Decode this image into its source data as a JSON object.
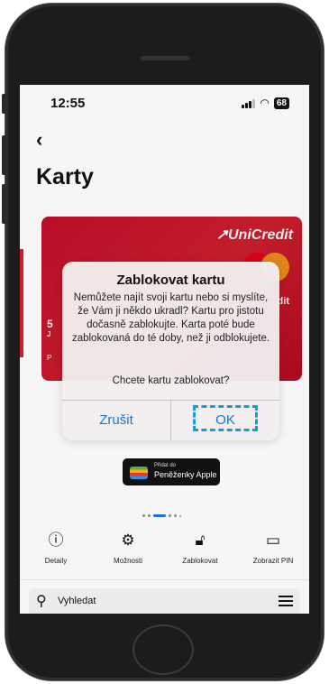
{
  "status_bar": {
    "time": "12:55",
    "battery": "68"
  },
  "nav": {
    "back_icon": "chevron-left-icon",
    "title": "Karty"
  },
  "card": {
    "brand": "UniCredit",
    "fragment_right": "dit",
    "fragment_5": "5",
    "fragment_j": "J",
    "fragment_p": "P"
  },
  "dialog": {
    "title": "Zablokovat kartu",
    "message": "Nemůžete najít svoji kartu nebo si myslíte, že Vám ji někdo ukradl? Kartu pro jistotu dočasně zablokujte. Karta poté bude zablokovaná do té doby, než ji odblokujete.",
    "question": "Chcete kartu zablokovat?",
    "cancel_label": "Zrušit",
    "ok_label": "OK"
  },
  "wallet": {
    "line1": "Přidat do",
    "line2": "Peněženky Apple"
  },
  "pager": {
    "count": 6,
    "active": 2
  },
  "actions": [
    {
      "label": "Detaily",
      "icon": "info-icon"
    },
    {
      "label": "Možnosti",
      "icon": "gear-icon"
    },
    {
      "label": "Zablokovat",
      "icon": "lock-icon"
    },
    {
      "label": "Zobrazit PIN",
      "icon": "card-pin-icon"
    }
  ],
  "search": {
    "placeholder": "Vyhledat"
  },
  "colors": {
    "accent": "#1a73d8",
    "card_red": "#c8102e",
    "highlight": "#1b9ad6"
  }
}
